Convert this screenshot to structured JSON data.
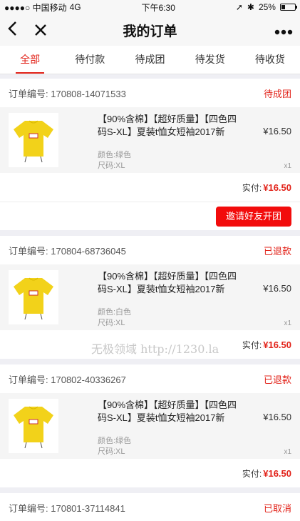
{
  "status_bar": {
    "carrier": "●●●●○ 中国移动",
    "network": "4G",
    "time": "下午6:30",
    "battery": "25%",
    "battery_level": 0.25
  },
  "nav": {
    "title": "我的订单"
  },
  "tabs": [
    {
      "label": "全部",
      "active": true
    },
    {
      "label": "待付款"
    },
    {
      "label": "待成团"
    },
    {
      "label": "待发货"
    },
    {
      "label": "待收货"
    }
  ],
  "orders": [
    {
      "order_label": "订单编号:",
      "order_no": "170808-14071533",
      "status": "待成团",
      "product": {
        "name": "【90%含棉】【超好质量】【四色四码S-XL】夏装t恤女短袖2017新",
        "color": "颜色:绿色",
        "size": "尺码:XL",
        "price": "¥16.50",
        "qty": "x1"
      },
      "paid_label": "实付:",
      "paid": "¥16.50",
      "action": "邀请好友开团"
    },
    {
      "order_label": "订单编号:",
      "order_no": "170804-68736045",
      "status": "已退款",
      "product": {
        "name": "【90%含棉】【超好质量】【四色四码S-XL】夏装t恤女短袖2017新",
        "color": "颜色:白色",
        "size": "尺码:XL",
        "price": "¥16.50",
        "qty": "x1"
      },
      "paid_label": "实付:",
      "paid": "¥16.50"
    },
    {
      "order_label": "订单编号:",
      "order_no": "170802-40336267",
      "status": "已退款",
      "product": {
        "name": "【90%含棉】【超好质量】【四色四码S-XL】夏装t恤女短袖2017新",
        "color": "颜色:绿色",
        "size": "尺码:XL",
        "price": "¥16.50",
        "qty": "x1"
      },
      "paid_label": "实付:",
      "paid": "¥16.50"
    },
    {
      "order_label": "订单编号:",
      "order_no": "170801-37114841",
      "status": "已取消"
    }
  ],
  "watermark": "无极领域 http://1230.la",
  "colors": {
    "accent": "#e2231a",
    "button": "#f20c0c",
    "shirt": "#f2d21a"
  },
  "icons": {
    "back": "chevron-left-icon",
    "close": "close-icon",
    "more": "more-dots-icon"
  }
}
